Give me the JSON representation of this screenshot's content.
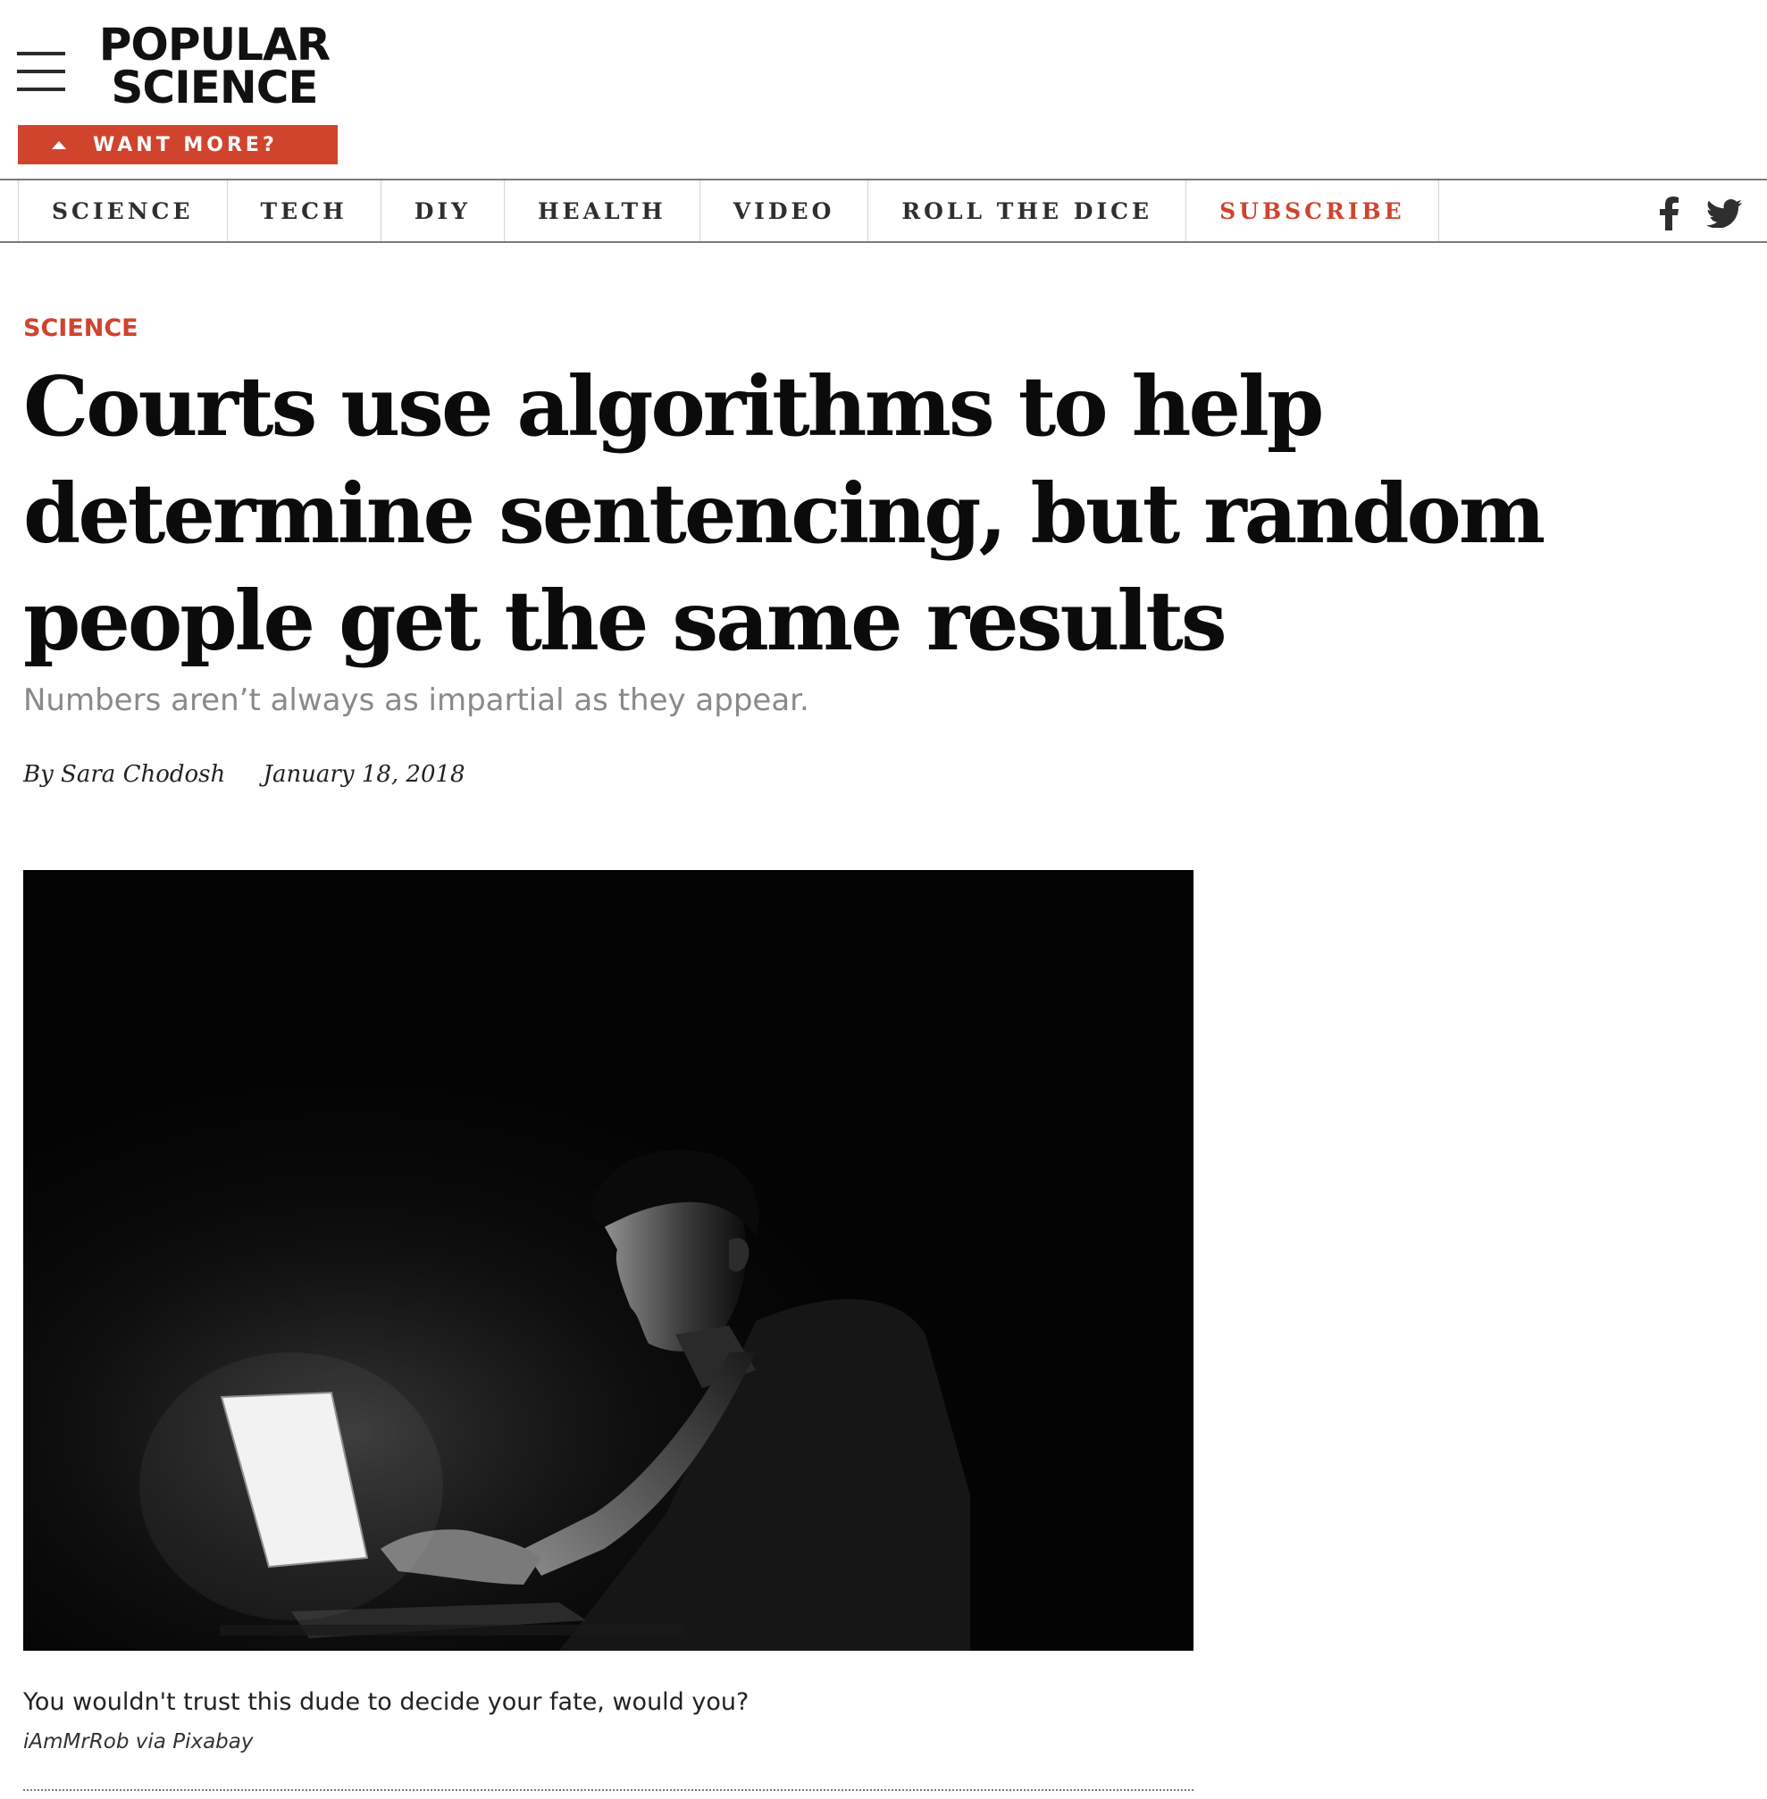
{
  "header": {
    "logo_line1": "POPULAR",
    "logo_line2": "SCIENCE",
    "want_more_label": "WANT MORE?",
    "accent_color": "#d0442e"
  },
  "nav": {
    "items": [
      {
        "label": "SCIENCE"
      },
      {
        "label": "TECH"
      },
      {
        "label": "DIY"
      },
      {
        "label": "HEALTH"
      },
      {
        "label": "VIDEO"
      },
      {
        "label": "ROLL THE DICE"
      },
      {
        "label": "SUBSCRIBE"
      }
    ],
    "social_icons": [
      "facebook-icon",
      "twitter-icon"
    ]
  },
  "article": {
    "kicker": "SCIENCE",
    "headline": "Courts use algorithms to help determine sentencing, but random people get the same results",
    "dek": "Numbers aren’t always as impartial as they appear.",
    "byline_author": "By Sara Chodosh",
    "byline_date": "January 18, 2018",
    "image": {
      "caption": "You wouldn't trust this dude to decide your fate, would you?",
      "credit": "iAmMrRob via Pixabay"
    }
  }
}
